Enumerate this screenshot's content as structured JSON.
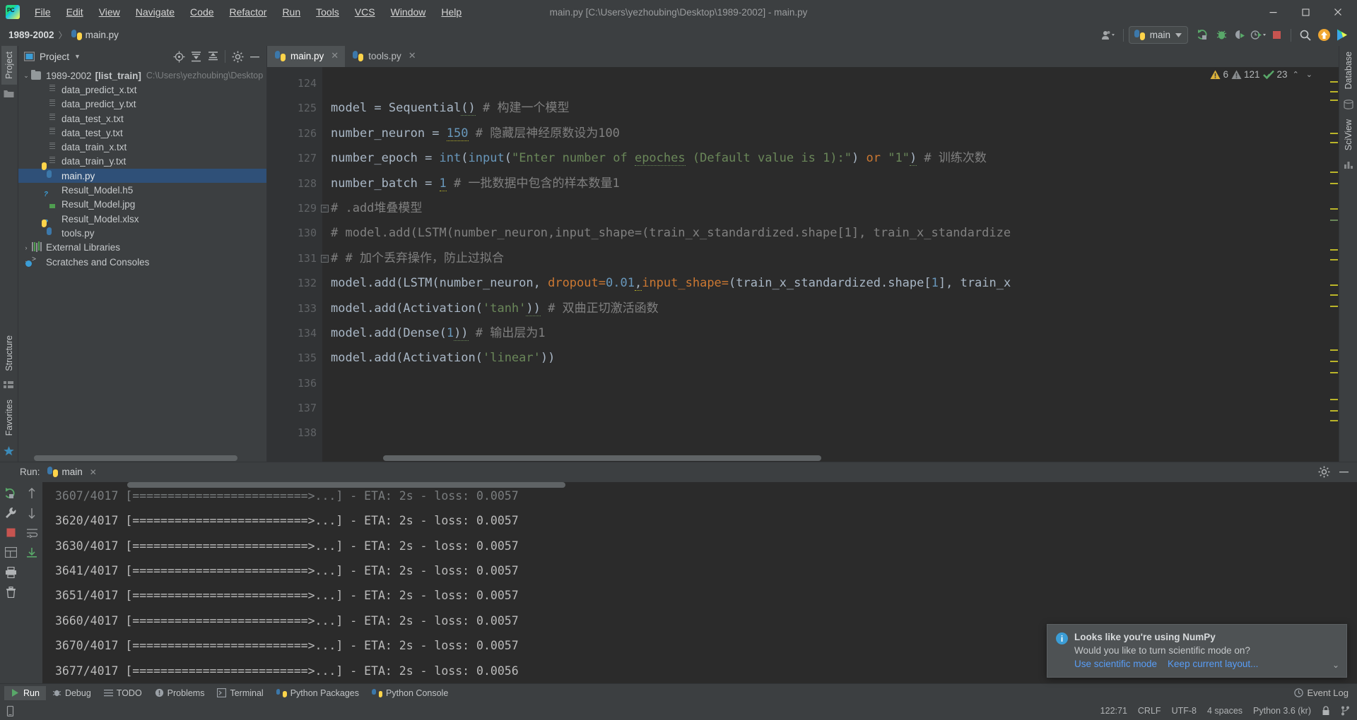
{
  "window": {
    "title": "main.py [C:\\Users\\yezhoubing\\Desktop\\1989-2002] - main.py",
    "minimize": "—",
    "maximize": "❐",
    "close": "✕"
  },
  "menu": [
    {
      "label": "File"
    },
    {
      "label": "Edit"
    },
    {
      "label": "View"
    },
    {
      "label": "Navigate"
    },
    {
      "label": "Code"
    },
    {
      "label": "Refactor"
    },
    {
      "label": "Run"
    },
    {
      "label": "Tools"
    },
    {
      "label": "VCS"
    },
    {
      "label": "Window"
    },
    {
      "label": "Help"
    }
  ],
  "breadcrumb": {
    "project": "1989-2002",
    "separator": "〉",
    "file": "main.py"
  },
  "toolbar": {
    "run_config": "main",
    "icons": [
      "person-dropdown-icon",
      "run-icon",
      "debug-icon",
      "coverage-icon",
      "profile-icon",
      "stop-icon",
      "search-icon",
      "update-icon",
      "datalore-icon"
    ]
  },
  "left_strip": {
    "project_tab": "Project",
    "structure_tab": "Structure",
    "favorites_tab": "Favorites"
  },
  "right_strip": {
    "database_tab": "Database",
    "sciview_tab": "SciView"
  },
  "project_panel": {
    "title": "Project",
    "tree": [
      {
        "name": "1989-2002",
        "badge": "[list_train]",
        "path": "C:\\Users\\yezhoubing\\Desktop",
        "icon": "folder-icon",
        "arrow": "⌄",
        "level": 0,
        "selected": false
      },
      {
        "name": "data_predict_x.txt",
        "icon": "text-file-icon",
        "level": 2,
        "selected": false
      },
      {
        "name": "data_predict_y.txt",
        "icon": "text-file-icon",
        "level": 2,
        "selected": false
      },
      {
        "name": "data_test_x.txt",
        "icon": "text-file-icon",
        "level": 2,
        "selected": false
      },
      {
        "name": "data_test_y.txt",
        "icon": "text-file-icon",
        "level": 2,
        "selected": false
      },
      {
        "name": "data_train_x.txt",
        "icon": "text-file-icon",
        "level": 2,
        "selected": false
      },
      {
        "name": "data_train_y.txt",
        "icon": "text-file-icon",
        "level": 2,
        "selected": false
      },
      {
        "name": "main.py",
        "icon": "python-file-icon",
        "level": 2,
        "selected": true
      },
      {
        "name": "Result_Model.h5",
        "icon": "unknown-file-icon",
        "level": 2,
        "selected": false
      },
      {
        "name": "Result_Model.jpg",
        "icon": "image-file-icon",
        "level": 2,
        "selected": false
      },
      {
        "name": "Result_Model.xlsx",
        "icon": "unknown-file-icon",
        "level": 2,
        "selected": false
      },
      {
        "name": "tools.py",
        "icon": "python-file-icon",
        "level": 2,
        "selected": false
      },
      {
        "name": "External Libraries",
        "icon": "library-icon",
        "arrow": "›",
        "level": 0,
        "selected": false
      },
      {
        "name": "Scratches and Consoles",
        "icon": "scratches-icon",
        "arrow": "›",
        "level": 0,
        "selected": false
      }
    ]
  },
  "editor": {
    "tabs": [
      {
        "label": "main.py",
        "active": true,
        "close": "✕"
      },
      {
        "label": "tools.py",
        "active": false,
        "close": "✕"
      }
    ],
    "inspection": {
      "warnings": "6",
      "weak_warnings": "121",
      "checks": "23",
      "up": "⌃",
      "down": "⌄"
    },
    "lines": [
      {
        "num": "124",
        "fold": "",
        "segments": []
      },
      {
        "num": "125",
        "fold": "",
        "segments": [
          {
            "t": "model ",
            "c": "pln"
          },
          {
            "t": "= ",
            "c": "pln"
          },
          {
            "t": "Sequential",
            "c": "pln"
          },
          {
            "t": "()",
            "c": "pln"
          },
          {
            "t": " # 构建一个模型",
            "c": "cmt"
          }
        ]
      },
      {
        "num": "126",
        "fold": "",
        "segments": [
          {
            "t": "number_neuron ",
            "c": "pln"
          },
          {
            "t": "= ",
            "c": "pln"
          },
          {
            "t": "150",
            "c": "num"
          },
          {
            "t": " # 隐藏层神经原数设为100",
            "c": "cmt"
          }
        ]
      },
      {
        "num": "127",
        "fold": "",
        "segments": [
          {
            "t": "number_epoch ",
            "c": "pln"
          },
          {
            "t": "= ",
            "c": "pln"
          },
          {
            "t": "int",
            "c": "num"
          },
          {
            "t": "(",
            "c": "pln"
          },
          {
            "t": "input",
            "c": "num"
          },
          {
            "t": "(",
            "c": "pln"
          },
          {
            "t": "\"Enter number of ",
            "c": "str"
          },
          {
            "t": "epoches",
            "c": "str"
          },
          {
            "t": " (Default value is 1):\"",
            "c": "str"
          },
          {
            "t": ") ",
            "c": "pln"
          },
          {
            "t": "or ",
            "c": "kw"
          },
          {
            "t": "\"1\"",
            "c": "str"
          },
          {
            "t": ")",
            "c": "pln"
          },
          {
            "t": " # 训练次数",
            "c": "cmt"
          }
        ]
      },
      {
        "num": "128",
        "fold": "",
        "segments": [
          {
            "t": "number_batch ",
            "c": "pln"
          },
          {
            "t": "= ",
            "c": "pln"
          },
          {
            "t": "1",
            "c": "num"
          },
          {
            "t": " # 一批数据中包含的样本数量1",
            "c": "cmt"
          }
        ]
      },
      {
        "num": "129",
        "fold": "−",
        "segments": [
          {
            "t": "# .add堆叠模型",
            "c": "cmt"
          }
        ]
      },
      {
        "num": "130",
        "fold": "",
        "segments": [
          {
            "t": "# model.add(LSTM(number_neuron,input_shape=(train_x_standardized.shape[1], train_x_standardize",
            "c": "cmt"
          }
        ]
      },
      {
        "num": "131",
        "fold": "−",
        "segments": [
          {
            "t": "# # 加个丢弃操作，防止过拟合",
            "c": "cmt"
          }
        ]
      },
      {
        "num": "132",
        "fold": "",
        "segments": [
          {
            "t": "model",
            "c": "pln"
          },
          {
            "t": ".add(",
            "c": "pln"
          },
          {
            "t": "LSTM",
            "c": "pln"
          },
          {
            "t": "(number_neuron, ",
            "c": "pln"
          },
          {
            "t": "dropout",
            "c": "param"
          },
          {
            "t": "=",
            "c": "kw"
          },
          {
            "t": "0.01",
            "c": "num"
          },
          {
            "t": ",",
            "c": "pln"
          },
          {
            "t": "input_shape",
            "c": "param"
          },
          {
            "t": "=",
            "c": "kw"
          },
          {
            "t": "(train_x_standardized.shape[",
            "c": "pln"
          },
          {
            "t": "1",
            "c": "num"
          },
          {
            "t": "], train_x",
            "c": "pln"
          }
        ]
      },
      {
        "num": "133",
        "fold": "",
        "segments": [
          {
            "t": "model",
            "c": "pln"
          },
          {
            "t": ".add(",
            "c": "pln"
          },
          {
            "t": "Activation",
            "c": "pln"
          },
          {
            "t": "(",
            "c": "pln"
          },
          {
            "t": "'tanh'",
            "c": "str"
          },
          {
            "t": "))",
            "c": "pln"
          },
          {
            "t": " # 双曲正切激活函数",
            "c": "cmt"
          }
        ]
      },
      {
        "num": "134",
        "fold": "",
        "segments": [
          {
            "t": "model",
            "c": "pln"
          },
          {
            "t": ".add(",
            "c": "pln"
          },
          {
            "t": "Dense",
            "c": "pln"
          },
          {
            "t": "(",
            "c": "pln"
          },
          {
            "t": "1",
            "c": "num"
          },
          {
            "t": "))",
            "c": "pln"
          },
          {
            "t": " # 输出层为1",
            "c": "cmt"
          }
        ]
      },
      {
        "num": "135",
        "fold": "",
        "segments": [
          {
            "t": "model",
            "c": "pln"
          },
          {
            "t": ".add(",
            "c": "pln"
          },
          {
            "t": "Activation",
            "c": "pln"
          },
          {
            "t": "(",
            "c": "pln"
          },
          {
            "t": "'linear'",
            "c": "str"
          },
          {
            "t": "))",
            "c": "pln"
          }
        ]
      },
      {
        "num": "136",
        "fold": "",
        "segments": []
      },
      {
        "num": "137",
        "fold": "",
        "segments": []
      },
      {
        "num": "138",
        "fold": "",
        "segments": []
      }
    ]
  },
  "run_panel": {
    "label": "Run:",
    "tab": "main",
    "tab_close": "✕",
    "console_lines": [
      "3607/4017 [=========================>...] - ETA: 2s - loss: 0.0057",
      "3620/4017 [=========================>...] - ETA: 2s - loss: 0.0057",
      "3630/4017 [=========================>...] - ETA: 2s - loss: 0.0057",
      "3641/4017 [=========================>...] - ETA: 2s - loss: 0.0057",
      "3651/4017 [=========================>...] - ETA: 2s - loss: 0.0057",
      "3660/4017 [=========================>...] - ETA: 2s - loss: 0.0057",
      "3670/4017 [=========================>...] - ETA: 2s - loss: 0.0057",
      "3677/4017 [=========================>...] - ETA: 2s - loss: 0.0056"
    ]
  },
  "notification": {
    "title": "Looks like you're using NumPy",
    "body": "Would you like to turn scientific mode on?",
    "action_primary": "Use scientific mode",
    "action_secondary": "Keep current layout...",
    "collapse": "⌄"
  },
  "tool_windows": [
    {
      "label": "Run",
      "icon": "run-icon",
      "active": true
    },
    {
      "label": "Debug",
      "icon": "debug-icon",
      "active": false
    },
    {
      "label": "TODO",
      "icon": "todo-icon",
      "active": false
    },
    {
      "label": "Problems",
      "icon": "problems-icon",
      "active": false
    },
    {
      "label": "Terminal",
      "icon": "terminal-icon",
      "active": false
    },
    {
      "label": "Python Packages",
      "icon": "packages-icon",
      "active": false
    },
    {
      "label": "Python Console",
      "icon": "python-console-icon",
      "active": false
    }
  ],
  "event_log": "Event Log",
  "status_bar": {
    "caret": "122:71",
    "line_sep": "CRLF",
    "encoding": "UTF-8",
    "indent": "4 spaces",
    "interpreter": "Python 3.6 (kr)",
    "lock_icon": "lock-icon",
    "vcs_icon": "branch-icon"
  },
  "colors": {
    "accent_blue": "#589df6",
    "selection": "#2f5078",
    "editor_bg": "#2b2b2b",
    "panel_bg": "#3c3f41",
    "warning_yellow": "#ddb33a",
    "green": "#4f9d50",
    "stop_red": "#c75450"
  }
}
